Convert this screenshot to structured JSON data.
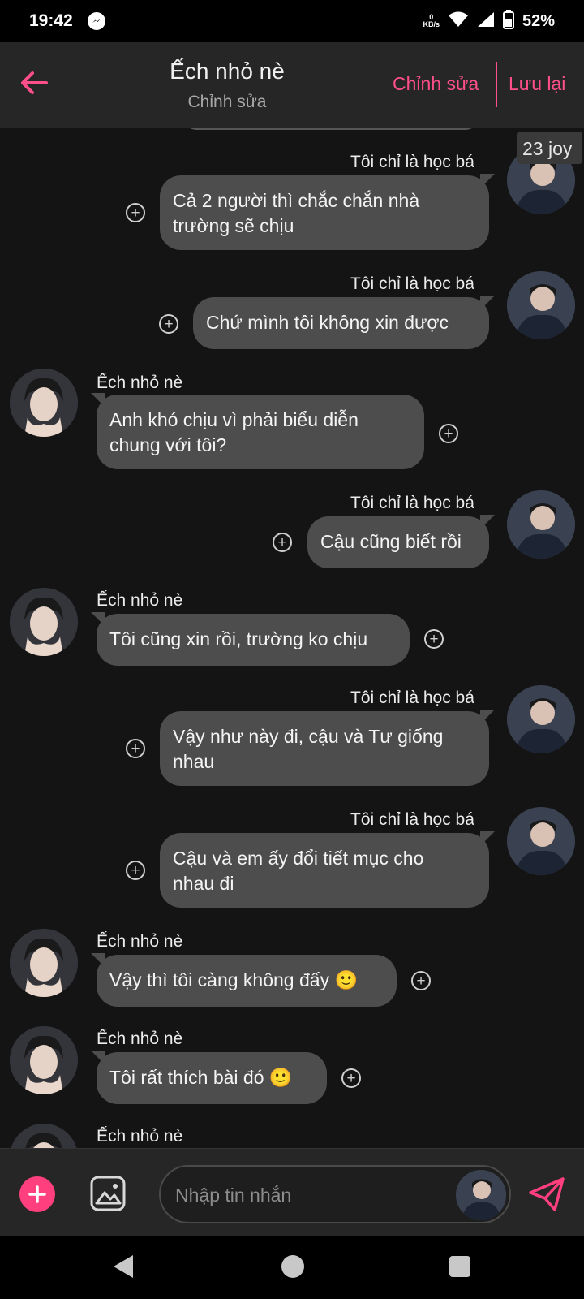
{
  "status_bar": {
    "time": "19:42",
    "net_speed_value": "0",
    "net_speed_unit": "KB/s",
    "battery": "52%"
  },
  "header": {
    "title": "Ếch nhỏ nè",
    "subtitle": "Chỉnh sửa",
    "edit_label": "Chỉnh sửa",
    "save_label": "Lưu lại"
  },
  "chat": {
    "corner_tag": "23 joy",
    "messages": [
      {
        "side": "right",
        "sender": "Tôi chỉ là học bá",
        "lines": [
          "Cả 2 người thì chắc chắn nhà",
          "trường sẽ chịu"
        ]
      },
      {
        "side": "right",
        "sender": "Tôi chỉ là học bá",
        "lines": [
          "Chứ mình tôi không xin được"
        ]
      },
      {
        "side": "left",
        "sender": "Ếch nhỏ nè",
        "lines": [
          "Anh khó chịu vì phải biểu diễn",
          "chung với tôi?"
        ]
      },
      {
        "side": "right",
        "sender": "Tôi chỉ là học bá",
        "lines": [
          "Cậu cũng biết rồi"
        ]
      },
      {
        "side": "left",
        "sender": "Ếch nhỏ nè",
        "lines": [
          "Tôi cũng xin rồi, trường ko chịu"
        ]
      },
      {
        "side": "right",
        "sender": "Tôi chỉ là học bá",
        "lines": [
          "Vậy như này đi, cậu và Tư giống",
          "nhau"
        ]
      },
      {
        "side": "right",
        "sender": "Tôi chỉ là học bá",
        "lines": [
          "Cậu và em ấy đổi tiết mục cho",
          "nhau đi"
        ]
      },
      {
        "side": "left",
        "sender": "Ếch nhỏ nè",
        "lines": [
          "Vậy thì tôi càng không đấy 🙂"
        ]
      },
      {
        "side": "left",
        "sender": "Ếch nhỏ nè",
        "lines": [
          "Tôi rất thích bài đó 🙂"
        ]
      },
      {
        "side": "left",
        "sender": "Ếch nhỏ nè",
        "lines": []
      }
    ]
  },
  "input": {
    "placeholder": "Nhập tin nhắn"
  },
  "colors": {
    "accent": "#ff4f8b",
    "bubble": "#4d4d4d",
    "background": "#141414",
    "header": "#262626"
  },
  "icons": {
    "back": "arrow-left-icon",
    "add": "plus-icon",
    "image": "image-icon",
    "send": "paper-plane-icon",
    "bubble_add": "circle-plus-icon"
  }
}
